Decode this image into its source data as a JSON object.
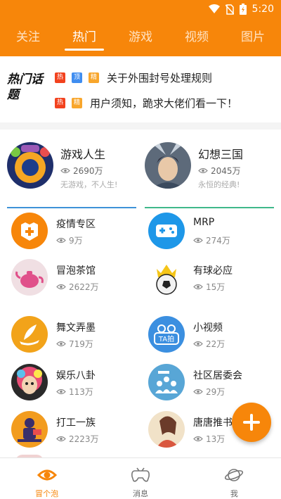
{
  "status_bar": {
    "time": "5:20"
  },
  "top_tabs": [
    {
      "label": "关注"
    },
    {
      "label": "热门"
    },
    {
      "label": "游戏"
    },
    {
      "label": "视频"
    },
    {
      "label": "图片"
    }
  ],
  "hot_topics": {
    "logo_text": "热门话题",
    "items": [
      {
        "tags": [
          "热",
          "顶",
          "精"
        ],
        "text": "关于外围封号处理规则"
      },
      {
        "tags": [
          "热",
          "精"
        ],
        "text": "用户须知，跪求大佬们看一下！"
      }
    ]
  },
  "featured": [
    {
      "name": "游戏人生",
      "views": "2690万",
      "desc": "无游戏，不人生!"
    },
    {
      "name": "幻想三国",
      "views": "2045万",
      "desc": "永恒的经典!"
    }
  ],
  "communities": [
    {
      "name": "疫情专区",
      "views": "9万"
    },
    {
      "name": "MRP",
      "views": "274万"
    },
    {
      "name": "冒泡茶馆",
      "views": "2622万"
    },
    {
      "name": "有球必应",
      "views": "15万"
    },
    {
      "name": "舞文弄墨",
      "views": "719万"
    },
    {
      "name": "小视频",
      "views": "22万"
    },
    {
      "name": "娱乐八卦",
      "views": "113万"
    },
    {
      "name": "社区居委会",
      "views": "29万"
    },
    {
      "name": "打工一族",
      "views": "2223万"
    },
    {
      "name": "唐唐推书",
      "views": "13万"
    }
  ],
  "bottom_tabs": [
    {
      "label": "冒个泡"
    },
    {
      "label": "消息"
    },
    {
      "label": "我"
    }
  ],
  "icon_labels": {
    "ta_pai": "TA拍"
  },
  "colors": {
    "accent": "#f7860a",
    "blue_line": "#3e92d8",
    "green_line": "#3fb88a"
  }
}
